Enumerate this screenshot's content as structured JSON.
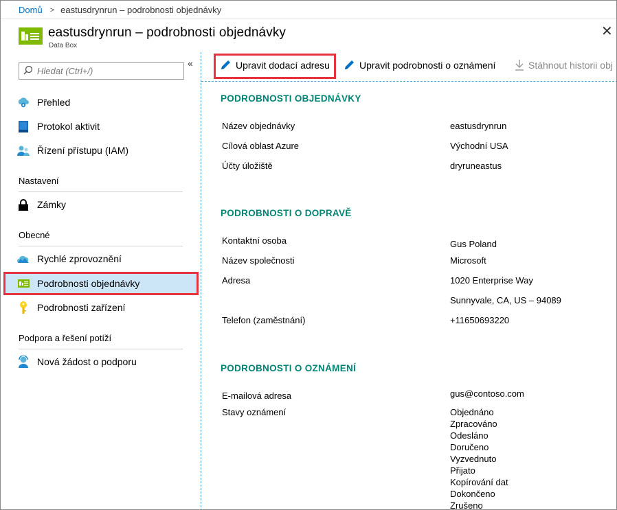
{
  "breadcrumb": {
    "home": "Domů",
    "current": "eastusdrynrun – podrobnosti objednávky"
  },
  "header": {
    "title": "eastusdrynrun – podrobnosti objednávky",
    "subtitle": "Data Box",
    "close": "✕"
  },
  "sidebar": {
    "search_placeholder": "Hledat (Ctrl+/)",
    "collapse": "«",
    "items_top": [
      {
        "label": "Přehled",
        "icon": "cloud-overview-icon"
      },
      {
        "label": "Protokol aktivit",
        "icon": "activity-log-icon"
      },
      {
        "label": "Řízení přístupu (IAM)",
        "icon": "iam-users-icon"
      }
    ],
    "section_settings": "Nastavení",
    "settings_items": [
      {
        "label": "Zámky",
        "icon": "lock-icon"
      }
    ],
    "section_general": "Obecné",
    "general_items": [
      {
        "label": "Rychlé zprovoznění",
        "icon": "quickstart-cloud-icon"
      },
      {
        "label": "Podrobnosti objednávky",
        "icon": "order-details-icon",
        "active": true
      },
      {
        "label": "Podrobnosti zařízení",
        "icon": "device-key-icon"
      }
    ],
    "section_support": "Podpora a řešení potíží",
    "support_items": [
      {
        "label": "Nová žádost o podporu",
        "icon": "support-person-icon"
      }
    ]
  },
  "toolbar": {
    "edit_address": "Upravit dodací adresu",
    "edit_notifications": "Upravit podrobnosti o oznámení",
    "download_history": "Stáhnout historii obj"
  },
  "order": {
    "title": "PODROBNOSTI OBJEDNÁVKY",
    "name_label": "Název objednávky",
    "name_value": "eastusdrynrun",
    "region_label": "Cílová oblast Azure",
    "region_value": "Východní USA",
    "storage_label": "Účty úložiště",
    "storage_value": "dryruneastus"
  },
  "shipping": {
    "title": "PODROBNOSTI O DOPRAVĚ",
    "contact_label": "Kontaktní osoba",
    "contact_value": "Gus Poland",
    "company_label": "Název společnosti",
    "company_value": "Microsoft",
    "address_label": "Adresa",
    "address_line1": "1020 Enterprise Way",
    "address_line2": "Sunnyvale, CA, US – 94089",
    "phone_label": "Telefon (zaměstnání)",
    "phone_value": "+11650693220"
  },
  "notification": {
    "title": "PODROBNOSTI O OZNÁMENÍ",
    "email_label": "E-mailová adresa",
    "email_value": "gus@contoso.com",
    "states_label": "Stavy oznámení",
    "states": [
      "Objednáno",
      "Zpracováno",
      "Odesláno",
      "Doručeno",
      "Vyzvednuto",
      "Přijato",
      "Kopírování dat",
      "Dokončeno",
      "Zrušeno"
    ]
  },
  "colors": {
    "accent_link": "#0072c6",
    "section_title": "#008575",
    "highlight": "#e5333f",
    "active_bg": "#cde6f7"
  }
}
